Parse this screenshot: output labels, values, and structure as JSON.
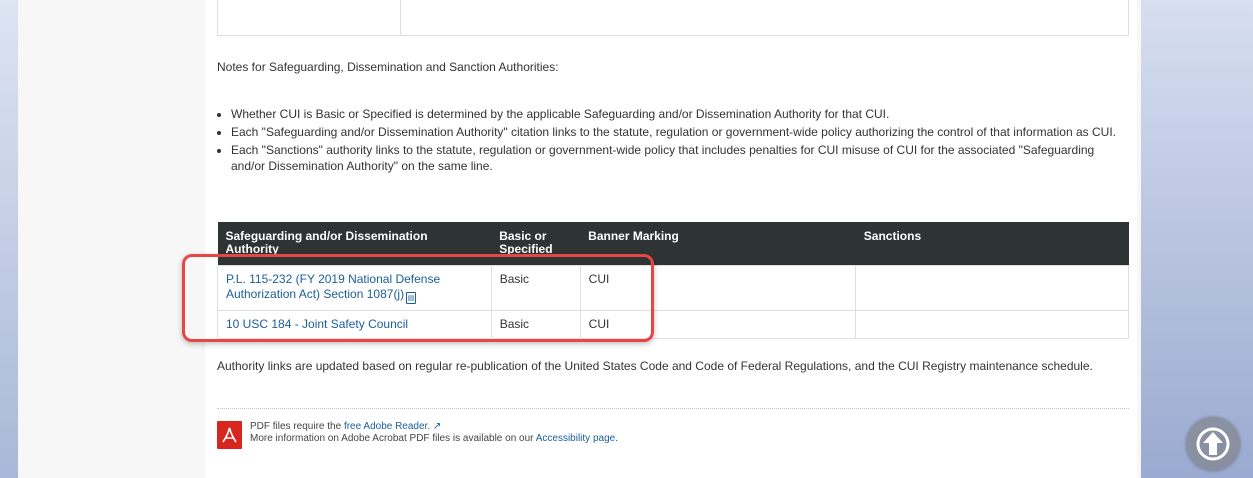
{
  "notes": {
    "title": "Notes for Safeguarding, Dissemination and Sanction Authorities:",
    "bullets": [
      "Whether CUI is Basic or Specified is determined by the applicable Safeguarding and/or Dissemination Authority for that CUI.",
      "Each \"Safeguarding and/or Dissemination Authority\" citation links to the statute, regulation or government-wide policy authorizing the control of that information as CUI.",
      "Each \"Sanctions\" authority links to the statute, regulation or government-wide policy that includes penalties for CUI misuse of CUI for the associated \"Safeguarding and/or Dissemination Authority\" on the same line."
    ]
  },
  "table": {
    "headers": [
      "Safeguarding and/or Dissemination Authority",
      "Basic or Specified",
      "Banner Marking",
      "Sanctions"
    ],
    "rows": [
      {
        "authority": "P.L. 115-232 (FY 2019 National Defense Authorization Act) Section 1087(j)",
        "type": "Basic",
        "marking": "CUI",
        "sanctions": ""
      },
      {
        "authority": "10 USC 184 - Joint Safety Council",
        "type": "Basic",
        "marking": "CUI",
        "sanctions": ""
      }
    ]
  },
  "authority_note": "Authority links are updated based on regular re-publication of the United States Code and Code of Federal Regulations, and the CUI Registry maintenance schedule.",
  "pdf_notice": {
    "line1_prefix": "PDF files require the ",
    "reader_link": "free Adobe Reader.",
    "line2_prefix": "More information on Adobe Acrobat PDF files is available on our ",
    "accessibility_link": "Accessibility page",
    "line2_suffix": "."
  },
  "icons": {
    "pdf": "pdf-file-icon",
    "external": "external-link-icon",
    "acrobat": "adobe-acrobat-icon",
    "scroll_top": "arrow-up-icon"
  },
  "colors": {
    "header_bg": "#2e3333",
    "link": "#1a5e9a",
    "highlight": "#e84545"
  }
}
